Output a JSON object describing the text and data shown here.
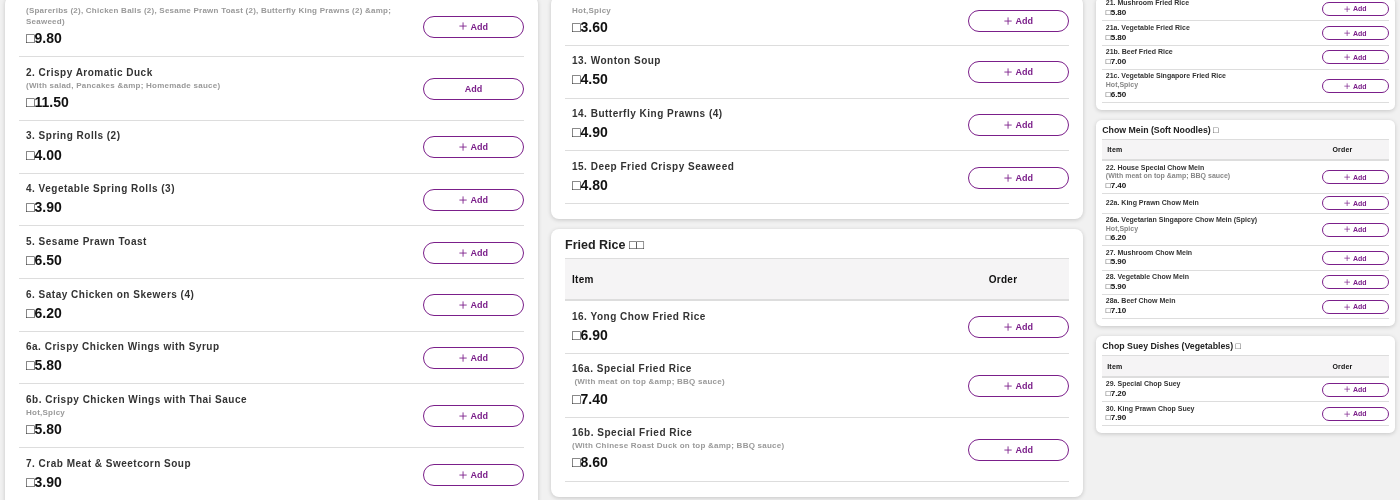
{
  "columns": [
    {
      "sections": [
        {
          "items": [
            {
              "description": "(Spareribs (2), Chicken Balls (2), Sesame Prawn Toast (2), Butterfly King Prawns (2) &amp; Seaweed)",
              "price": "□9.80",
              "button": "Add",
              "plus_icon": true
            },
            {
              "name": "2. Crispy Aromatic Duck",
              "description": "(With salad, Pancakes &amp; Homemade sauce)",
              "price": "□11.50",
              "button": "Add",
              "plus_icon": false
            },
            {
              "name": "3. Spring Rolls (2)",
              "price": "□4.00",
              "button": "Add",
              "plus_icon": true
            },
            {
              "name": "4. Vegetable Spring Rolls (3)",
              "price": "□3.90",
              "button": "Add",
              "plus_icon": true
            },
            {
              "name": "5. Sesame Prawn Toast",
              "price": "□6.50",
              "button": "Add",
              "plus_icon": true
            },
            {
              "name": "6. Satay Chicken on Skewers (4)",
              "price": "□6.20",
              "button": "Add",
              "plus_icon": true
            },
            {
              "name": "6a. Crispy Chicken Wings with Syrup",
              "price": "□5.80",
              "button": "Add",
              "plus_icon": true
            },
            {
              "name": "6b. Crispy Chicken Wings with Thai Sauce",
              "description": "Hot,Spicy",
              "price": "□5.80",
              "button": "Add",
              "plus_icon": true
            },
            {
              "name": "7. Crab Meat & Sweetcorn Soup",
              "price": "□3.90",
              "button": "Add",
              "plus_icon": true
            }
          ]
        }
      ]
    },
    {
      "sections": [
        {
          "items": [
            {
              "description": "Hot,Spicy",
              "price": "□3.60",
              "button": "Add",
              "plus_icon": true
            },
            {
              "name": "13. Wonton Soup",
              "price": "□4.50",
              "button": "Add",
              "plus_icon": true
            },
            {
              "name": "14. Butterfly King Prawns (4)",
              "price": "□4.90",
              "button": "Add",
              "plus_icon": true
            },
            {
              "name": "15. Deep Fried Crispy Seaweed",
              "price": "□4.80",
              "button": "Add",
              "plus_icon": true
            }
          ]
        },
        {
          "title": "Fried Rice □□",
          "header": {
            "item": "Item",
            "order": "Order"
          },
          "items": [
            {
              "name": "16. Yong Chow Fried Rice",
              "price": "□6.90",
              "button": "Add",
              "plus_icon": true
            },
            {
              "name": "16a. Special Fried Rice",
              "description": " (With meat on top &amp; BBQ sauce)",
              "price": "□7.40",
              "button": "Add",
              "plus_icon": true
            },
            {
              "name": "16b. Special Fried Rice",
              "description": "(With Chinese Roast Duck on top &amp; BBQ sauce)",
              "price": "□8.60",
              "button": "Add",
              "plus_icon": true
            }
          ]
        }
      ]
    },
    {
      "sections": [
        {
          "items": [
            {
              "name": "21. Mushroom Fried Rice",
              "price": "□5.80",
              "button": "Add",
              "plus_icon": true
            },
            {
              "name": "21a. Vegetable Fried Rice",
              "price": "□5.80",
              "button": "Add",
              "plus_icon": true
            },
            {
              "name": "21b. Beef Fried Rice",
              "price": "□7.00",
              "button": "Add",
              "plus_icon": true
            },
            {
              "name": "21c. Vegetable Singapore Fried Rice",
              "description": "Hot,Spicy",
              "price": "□6.50",
              "button": "Add",
              "plus_icon": true
            }
          ]
        },
        {
          "title": "Chow Mein (Soft Noodles) □",
          "header": {
            "item": "Item",
            "order": "Order"
          },
          "items": [
            {
              "name": "22. House Special Chow Mein",
              "description": "(With meat on top &amp; BBQ sauce)",
              "price": "□7.40",
              "button": "Add",
              "plus_icon": true
            },
            {
              "name": "22a. King Prawn Chow Mein",
              "button": "Add",
              "plus_icon": true
            },
            {
              "name": "26a. Vegetarian Singapore Chow Mein (Spicy)",
              "description": "Hot,Spicy",
              "price": "□6.20",
              "button": "Add",
              "plus_icon": true
            },
            {
              "name": "27. Mushroom Chow Mein",
              "price": "□5.90",
              "button": "Add",
              "plus_icon": true
            },
            {
              "name": "28. Vegetable Chow Mein",
              "price": "□5.90",
              "button": "Add",
              "plus_icon": true
            },
            {
              "name": "28a. Beef Chow Mein",
              "price": "□7.10",
              "button": "Add",
              "plus_icon": true
            }
          ]
        },
        {
          "title": "Chop Suey Dishes (Vegetables) □",
          "header": {
            "item": "Item",
            "order": "Order"
          },
          "items": [
            {
              "name": "29. Special Chop Suey",
              "price": "□7.20",
              "button": "Add",
              "plus_icon": true
            },
            {
              "name": "30. King Prawn Chop Suey",
              "price": "□7.90",
              "button": "Add",
              "plus_icon": true
            }
          ]
        }
      ]
    }
  ]
}
